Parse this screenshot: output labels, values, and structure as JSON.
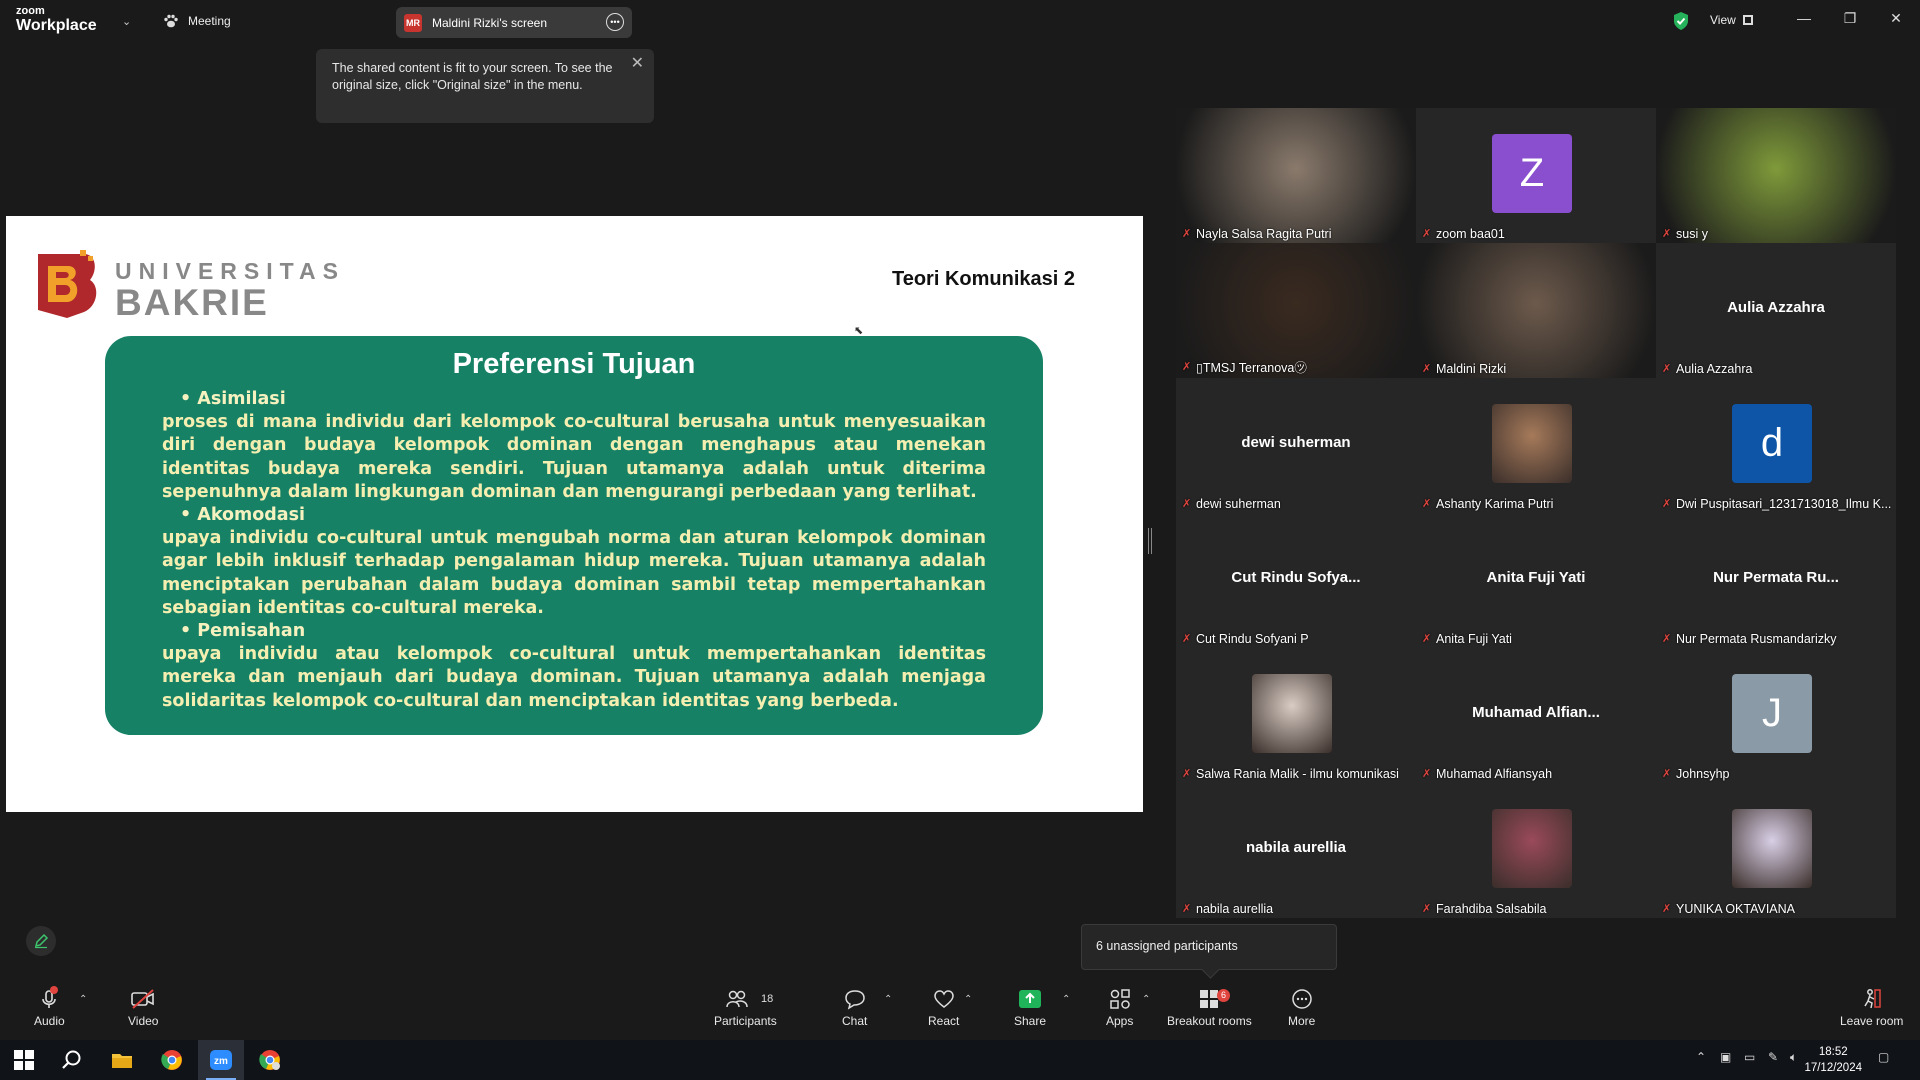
{
  "app": {
    "brand_top": "zoom",
    "brand_bottom": "Workplace",
    "meeting_label": "Meeting"
  },
  "share_pill": {
    "initials": "MR",
    "label": "Maldini Rizki's screen"
  },
  "view_label": "View",
  "tooltip": {
    "text": "The shared content is fit to your screen. To see the original size, click \"Original size\" in the menu."
  },
  "slide": {
    "logo_top": "UNIVERSITAS",
    "logo_bottom": "BAKRIE",
    "course": "Teori  Komunikasi 2",
    "heading": "Preferensi Tujuan",
    "sections": [
      {
        "title": "• Asimilasi",
        "body": "proses di mana individu dari kelompok co-cultural berusaha untuk menyesuaikan diri dengan budaya kelompok dominan dengan menghapus atau menekan identitas budaya mereka sendiri. Tujuan utamanya adalah untuk diterima sepenuhnya dalam lingkungan dominan dan mengurangi perbedaan yang terlihat."
      },
      {
        "title": "• Akomodasi",
        "body": "upaya individu co-cultural untuk mengubah norma dan aturan kelompok dominan agar lebih inklusif terhadap pengalaman hidup mereka. Tujuan utamanya adalah menciptakan perubahan dalam budaya dominan sambil tetap mempertahankan sebagian identitas co-cultural mereka."
      },
      {
        "title": "• Pemisahan",
        "body": "upaya individu atau kelompok co-cultural untuk mempertahankan identitas mereka dan menjauh dari budaya dominan. Tujuan utamanya adalah menjaga solidaritas kelompok co-cultural dan menciptakan identitas yang berbeda."
      }
    ]
  },
  "participants": [
    {
      "name": "Nayla Salsa Ragita Putri",
      "kind": "video",
      "color": "#8a7a6c"
    },
    {
      "name": "zoom baa01",
      "kind": "avatar",
      "letter": "Z",
      "color": "#8a4fcf"
    },
    {
      "name": "susi y",
      "kind": "video",
      "color": "#7f9a3a"
    },
    {
      "name": "▯TMSJ Terranova㋡",
      "kind": "video",
      "color": "#3a2a20"
    },
    {
      "name": "Maldini Rizki",
      "kind": "video",
      "color": "#6d5a4c"
    },
    {
      "name": "Aulia Azzahra",
      "kind": "name",
      "center": "Aulia Azzahra"
    },
    {
      "name": "dewi suherman",
      "kind": "name",
      "center": "dewi suherman"
    },
    {
      "name": "Ashanty Karima Putri",
      "kind": "photo",
      "color": "#a67a5a"
    },
    {
      "name": "Dwi Puspitasari_1231713018_Ilmu K...",
      "kind": "avatar",
      "letter": "d",
      "color": "#0e55a8"
    },
    {
      "name": "Cut Rindu Sofyani P",
      "kind": "name",
      "center": "Cut Rindu Sofya..."
    },
    {
      "name": "Anita Fuji Yati",
      "kind": "name",
      "center": "Anita Fuji Yati"
    },
    {
      "name": "Nur Permata Rusmandarizky",
      "kind": "name",
      "center": "Nur Permata Ru..."
    },
    {
      "name": "Salwa Rania Malik - ilmu komunikasi",
      "kind": "photo",
      "color": "#d8ccc4"
    },
    {
      "name": "Muhamad Alfiansyah",
      "kind": "name",
      "center": "Muhamad  Alfian..."
    },
    {
      "name": "Johnsyhp",
      "kind": "avatar",
      "letter": "J",
      "color": "#8a9aa6"
    },
    {
      "name": "nabila aurellia",
      "kind": "name",
      "center": "nabila aurellia"
    },
    {
      "name": "Farahdiba Salsabila",
      "kind": "photo",
      "color": "#9a4a5a"
    },
    {
      "name": "YUNIKA OKTAVIANA",
      "kind": "photo",
      "color": "#d9cfe6"
    }
  ],
  "unassigned": "6 unassigned participants",
  "toolbar": {
    "audio": "Audio",
    "video": "Video",
    "participants": "Participants",
    "participants_count": "18",
    "chat": "Chat",
    "react": "React",
    "share": "Share",
    "apps": "Apps",
    "breakout": "Breakout rooms",
    "breakout_badge": "6",
    "more": "More",
    "leave": "Leave room"
  },
  "taskbar": {
    "time": "18:52",
    "date": "17/12/2024"
  },
  "colors": {
    "accent_green": "#178166",
    "share_green": "#20b45a",
    "mute_red": "#e0443e"
  }
}
